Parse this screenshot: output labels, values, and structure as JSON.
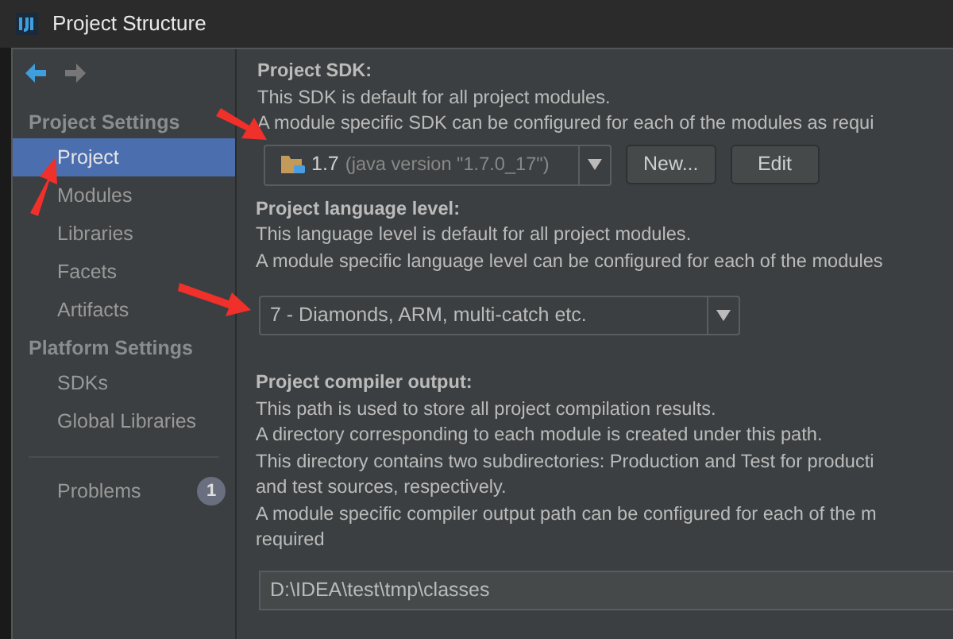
{
  "window": {
    "title": "Project Structure"
  },
  "sidebar": {
    "sections": [
      {
        "title": "Project Settings",
        "items": [
          {
            "label": "Project",
            "selected": true
          },
          {
            "label": "Modules",
            "selected": false
          },
          {
            "label": "Libraries",
            "selected": false
          },
          {
            "label": "Facets",
            "selected": false
          },
          {
            "label": "Artifacts",
            "selected": false
          }
        ]
      },
      {
        "title": "Platform Settings",
        "items": [
          {
            "label": "SDKs",
            "selected": false
          },
          {
            "label": "Global Libraries",
            "selected": false
          }
        ]
      }
    ],
    "problems": {
      "label": "Problems",
      "count": "1"
    }
  },
  "sdk": {
    "title": "Project SDK:",
    "lines": [
      "This SDK is default for all project modules.",
      "A module specific SDK can be configured for each of the modules as requi"
    ],
    "combo": {
      "version": "1.7",
      "detail": "(java version \"1.7.0_17\")"
    },
    "buttons": [
      "New...",
      "Edit"
    ]
  },
  "language": {
    "title": "Project language level:",
    "lines": [
      "This language level is default for all project modules.",
      "A module specific language level can be configured for each of the modules"
    ],
    "combo": {
      "value": "7 - Diamonds, ARM, multi-catch etc."
    }
  },
  "compiler": {
    "title": "Project compiler output:",
    "lines": [
      "This path is used to store all project compilation results.",
      "A directory corresponding to each module is created under this path.",
      "This directory contains two subdirectories: Production and Test for producti",
      "and test sources, respectively.",
      "A module specific compiler output path can be configured for each of the m",
      "required"
    ],
    "path": "D:\\IDEA\\test\\tmp\\classes"
  }
}
